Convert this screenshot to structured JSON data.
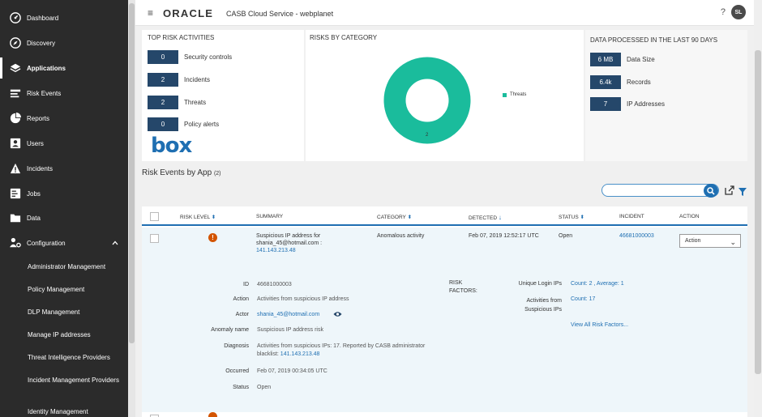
{
  "sidebar": {
    "items": [
      {
        "label": "Dashboard",
        "icon": "dashboard-icon"
      },
      {
        "label": "Discovery",
        "icon": "discovery-icon"
      },
      {
        "label": "Applications",
        "icon": "applications-icon"
      },
      {
        "label": "Risk Events",
        "icon": "risk-events-icon"
      },
      {
        "label": "Reports",
        "icon": "reports-icon"
      },
      {
        "label": "Users",
        "icon": "users-icon"
      },
      {
        "label": "Incidents",
        "icon": "incidents-icon"
      },
      {
        "label": "Jobs",
        "icon": "jobs-icon"
      },
      {
        "label": "Data",
        "icon": "data-icon"
      },
      {
        "label": "Configuration",
        "icon": "configuration-icon"
      }
    ],
    "sub_items": [
      "Administrator Management",
      "Policy Management",
      "DLP Management",
      "Manage IP addresses",
      "Threat Intelligence Providers",
      "Incident Management Providers",
      "Identity Management"
    ]
  },
  "header": {
    "menu_icon": "≡",
    "brand": "ORACLE",
    "title": "CASB Cloud Service - webplanet",
    "help": "?",
    "avatar": "SL"
  },
  "top_risk": {
    "title": "TOP RISK ACTIVITIES",
    "rows": [
      {
        "value": "0",
        "label": "Security controls"
      },
      {
        "value": "2",
        "label": "Incidents"
      },
      {
        "value": "2",
        "label": "Threats"
      },
      {
        "value": "0",
        "label": "Policy alerts"
      }
    ],
    "app_logo": "box"
  },
  "risk_by_category": {
    "title": "RISKS BY CATEGORY",
    "legend": "Threats",
    "donut_label": "2",
    "color": "#1abc9c"
  },
  "data_processed": {
    "title": "DATA PROCESSED IN THE LAST 90 DAYS",
    "rows": [
      {
        "value": "6 MB",
        "label": "Data Size"
      },
      {
        "value": "6.4k",
        "label": "Records"
      },
      {
        "value": "7",
        "label": "IP Addresses"
      }
    ]
  },
  "risk_events": {
    "title": "Risk Events by App",
    "count": "(2)",
    "search_placeholder": "",
    "columns": [
      "RISK LEVEL",
      "SUMMARY",
      "CATEGORY",
      "DETECTED",
      "STATUS",
      "INCIDENT",
      "ACTION"
    ],
    "row": {
      "summary_line1": "Suspicious IP address for",
      "summary_line2": "shania_45@hotmail.com :",
      "summary_ip": "141.143.213.48",
      "category": "Anomalous activity",
      "detected": "Feb 07, 2019 12:52:17 UTC",
      "status": "Open",
      "incident": "46681000003",
      "action": "Action"
    },
    "details": {
      "id_label": "ID",
      "id": "46681000003",
      "action_label": "Action",
      "action": "Activities from suspicious IP address",
      "actor_label": "Actor",
      "actor": "shania_45@hotmail.com",
      "anomaly_label": "Anomaly name",
      "anomaly": "Suspicious IP address risk",
      "diagnosis_label": "Diagnosis",
      "diagnosis_line1": "Activities from suspicious IPs: 17. Reported by CASB administrator",
      "diagnosis_line2": "blacklist:",
      "diagnosis_ip": "141.143.213.48",
      "occurred_label": "Occurred",
      "occurred": "Feb 07, 2019 00:34:05 UTC",
      "status_label": "Status",
      "status": "Open",
      "risk_factors_line1": "RISK",
      "risk_factors_line2": "FACTORS:",
      "unique_login_label": "Unique Login IPs",
      "unique_login_value": "Count: 2 , Average: 1",
      "activities_label_line1": "Activities from",
      "activities_label_line2": "Suspicious IPs",
      "activities_value": "Count: 17",
      "view_all": "View All Risk Factors..."
    }
  }
}
